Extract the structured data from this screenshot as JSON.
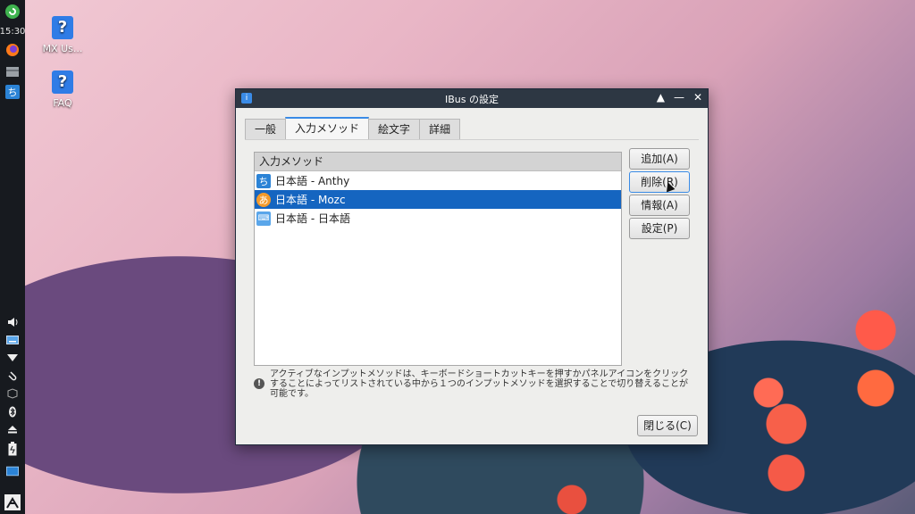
{
  "taskbar": {
    "clock": "15:30",
    "icons": [
      "mx-logo-icon",
      "firefox-icon",
      "file-manager-icon",
      "ibus-chi-icon"
    ],
    "tray": [
      "volume-icon",
      "keyboard-icon",
      "network-icon",
      "clipboard-icon",
      "package-icon",
      "bluetooth-icon",
      "eject-icon",
      "battery-icon",
      "workspace-icon",
      "system-menu-icon"
    ],
    "ibus_glyph": "ち"
  },
  "desktop": {
    "icons": [
      {
        "label": "MX Us...",
        "glyph": "?"
      },
      {
        "label": "FAQ",
        "glyph": "?"
      }
    ]
  },
  "dialog": {
    "title": "IBus の設定",
    "title_icon_glyph": "i",
    "tabs": [
      "一般",
      "入力メソッド",
      "絵文字",
      "詳細"
    ],
    "active_tab": "入力メソッド",
    "list": {
      "header": "入力メソッド",
      "rows": [
        {
          "label": "日本語 - Anthy",
          "icon": "ち",
          "selected": false
        },
        {
          "label": "日本語 - Mozc",
          "icon": "あ",
          "selected": true
        },
        {
          "label": "日本語 - 日本語",
          "icon": "⌨",
          "selected": false
        }
      ]
    },
    "buttons": {
      "add": "追加(A)",
      "remove": "削除(R)",
      "info": "情報(A)",
      "settings": "設定(P)"
    },
    "info_glyph": "!",
    "info_text": "アクティブなインプットメソッドは、キーボードショートカットキーを押すかパネルアイコンをクリックすることによってリストされている中から１つのインプットメソッドを選択することで切り替えることが可能です。",
    "close_label": "閉じる(C)"
  },
  "colors": {
    "selection": "#1565c0",
    "titlebar": "#2d3743",
    "accent": "#3a8be6"
  }
}
